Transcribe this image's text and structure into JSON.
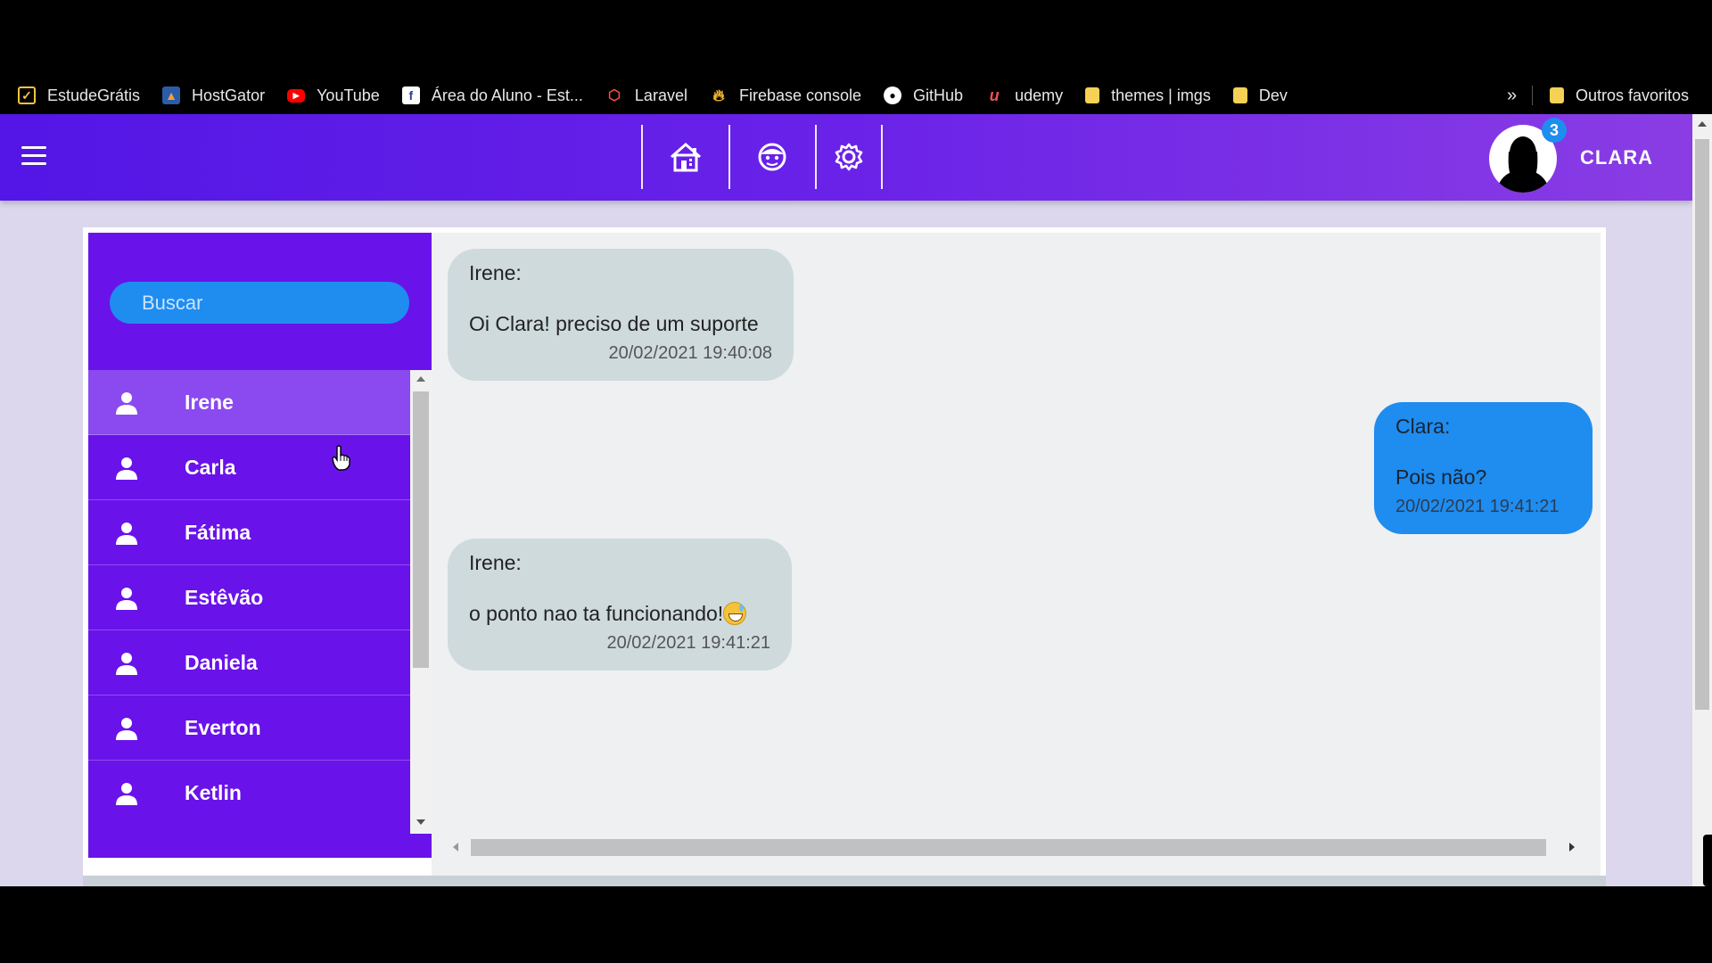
{
  "bookmarks": {
    "items": [
      {
        "label": "EstudeGrátis",
        "icon": "checkbox-icon",
        "color": "#f5c542"
      },
      {
        "label": "HostGator",
        "icon": "hostgator-icon",
        "color": "#f2a23a"
      },
      {
        "label": "YouTube",
        "icon": "youtube-icon",
        "color": "#ff0000"
      },
      {
        "label": "Área do Aluno - Est...",
        "icon": "book-icon",
        "color": "#2a3e9a"
      },
      {
        "label": "Laravel",
        "icon": "laravel-icon",
        "color": "#f05340"
      },
      {
        "label": "Firebase console",
        "icon": "firebase-icon",
        "color": "#f8b82e"
      },
      {
        "label": "GitHub",
        "icon": "github-icon",
        "color": "#ffffff"
      },
      {
        "label": "udemy",
        "icon": "udemy-icon",
        "color": "#ec5252"
      },
      {
        "label": "themes | imgs",
        "icon": "folder-icon",
        "color": "#f5d155"
      },
      {
        "label": "Dev",
        "icon": "folder-icon",
        "color": "#f5d155"
      }
    ],
    "more": "»",
    "other": "Outros favoritos"
  },
  "header": {
    "user": "CLARA",
    "notifications": "3",
    "nav": [
      "home-icon",
      "face-icon",
      "gear-icon"
    ]
  },
  "search": {
    "placeholder": "Buscar"
  },
  "contacts": [
    "Irene",
    "Carla",
    "Fátima",
    "Estêvão",
    "Daniela",
    "Everton",
    "Ketlin"
  ],
  "messages": [
    {
      "from": "Irene:",
      "text": "Oi Clara! preciso de um suporte",
      "time": "20/02/2021 19:40:08"
    },
    {
      "from": "Clara:",
      "text": "Pois não?",
      "time": "20/02/2021 19:41:21"
    },
    {
      "from": "Irene:",
      "text": "o ponto nao ta funcionando!",
      "time": "20/02/2021 19:41:21"
    }
  ],
  "colors": {
    "header": "#5a1ae6",
    "sidebar": "#6a12ea",
    "outgoing": "#1f8cf0",
    "incoming": "#cfdadd"
  }
}
